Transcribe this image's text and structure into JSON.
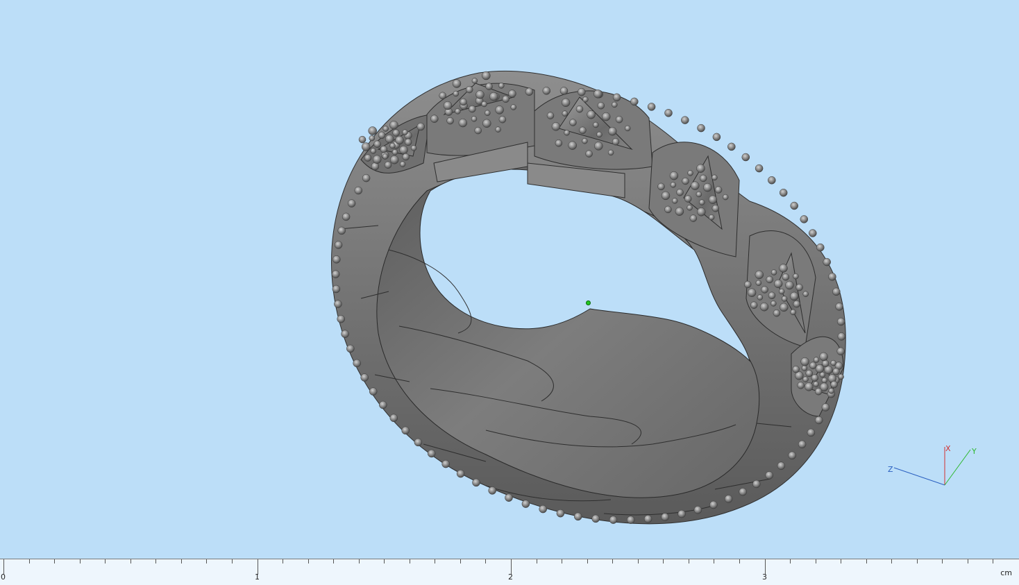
{
  "viewport": {
    "background": "#bcdef8",
    "model": "ring-3d-model",
    "ring_color": "#7c7c7c"
  },
  "triad": {
    "x_label": "X",
    "y_label": "Y",
    "z_label": "Z",
    "x_color": "#d23030",
    "y_color": "#2fb82f",
    "z_color": "#2a5fc0"
  },
  "ruler": {
    "labels": [
      "0",
      "1",
      "2",
      "3"
    ],
    "unit": "cm"
  }
}
